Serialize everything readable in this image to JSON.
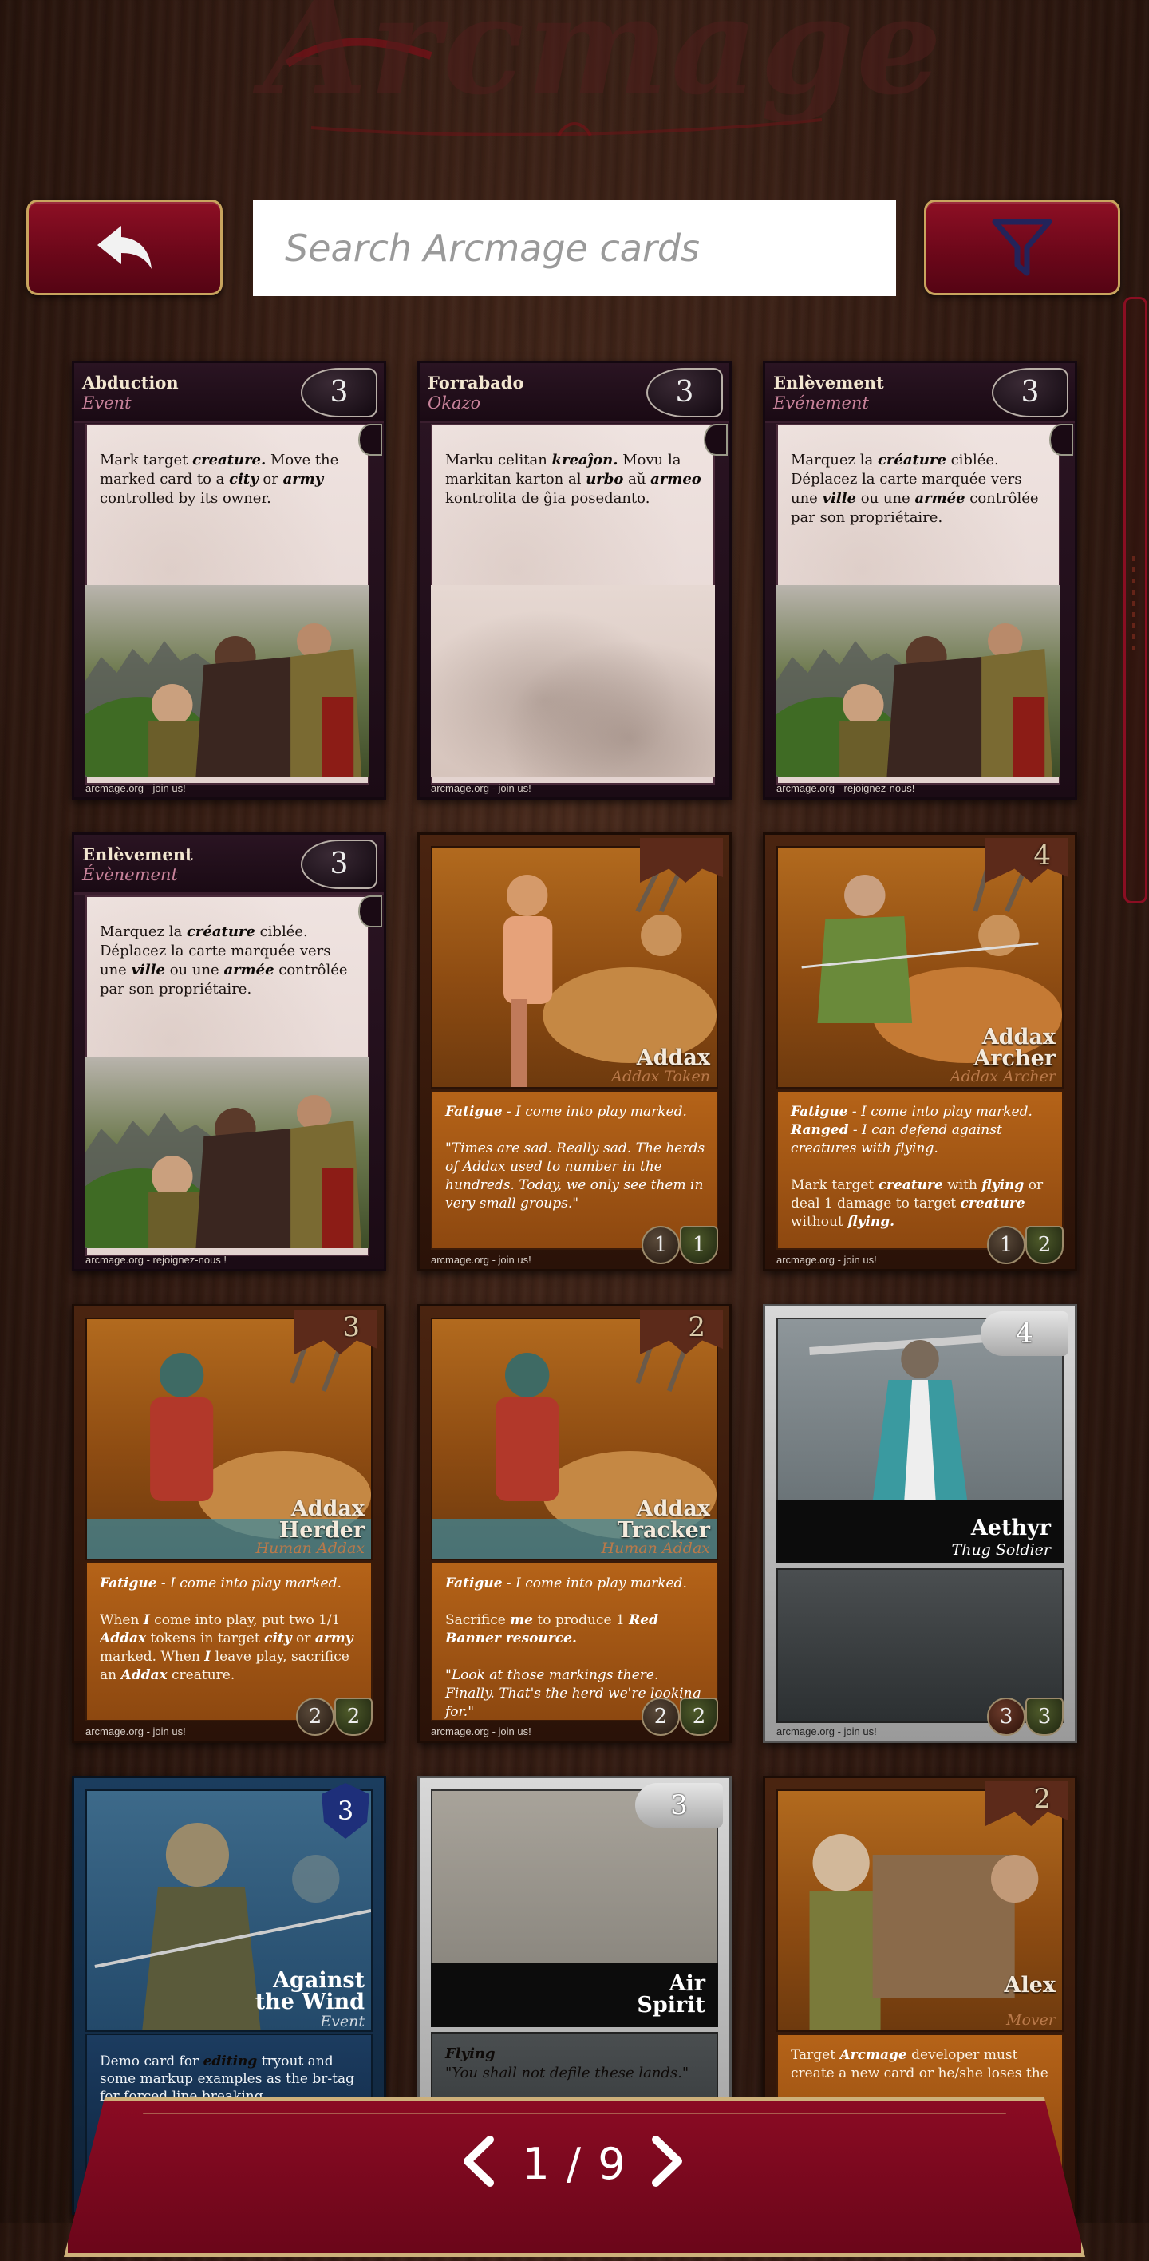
{
  "header": {
    "logo_text": "Arcmage"
  },
  "toolbar": {
    "back_icon": "back-arrow-icon",
    "search_placeholder": "Search Arcmage cards",
    "filter_icon": "filter-funnel-icon"
  },
  "cards": [
    {
      "name": "Abduction",
      "type": "Event",
      "cost": "3",
      "rules_html": "Mark target <b><i>creature.</i></b> Move the marked card to a <b><i>city</i></b> or <b><i>army</i></b> controlled by its owner.",
      "footer": "arcmage.org - join us!"
    },
    {
      "name": "Forrabado",
      "type": "Okazo",
      "cost": "3",
      "rules_html": "Marku celitan <b><i>kreaĵon.</i></b> Movu la markitan karton al <b><i>urbo</i></b>  aŭ <b><i>armeo</i></b> kontrolita de ĝia posedanto.",
      "footer": "arcmage.org - join us!"
    },
    {
      "name": "Enlèvement",
      "type": "Evénement",
      "cost": "3",
      "rules_html": "Marquez la <b><i>créature</i></b> ciblée. Déplacez la carte marquée vers une <b><i>ville</i></b> ou une <b><i>armée</i></b> contrôlée par son propriétaire.",
      "footer": "arcmage.org - rejoignez-nous!"
    },
    {
      "name": "Enlèvement",
      "type": "Évènement",
      "cost": "3",
      "rules_html": "Marquez la <b><i>créature</i></b> ciblée.<br>Déplacez la carte marquée vers une <b><i>ville</i></b> ou une <b><i>armée</i></b> contrôlée par son propriétaire.",
      "footer": "arcmage.org - rejoignez-nous !"
    },
    {
      "name": "Addax",
      "type": "Addax Token",
      "cost": "",
      "rules_html": "<b><i>Fatigue</i></b><i> - I come into play marked.</i><br><br><i>\"Times are sad. Really sad. The herds of Addax used to number in the hundreds. Today, we only see them in very small groups.\"</i>",
      "stats": [
        "1",
        "1"
      ],
      "footer": "arcmage.org - join us!"
    },
    {
      "name": "Addax Archer",
      "type": "Addax Archer",
      "cost": "4",
      "rules_html": "<b><i>Fatigue</i></b><i> - I come into play marked.</i><br><b><i>Ranged</i></b><i> - I can defend against creatures with flying.</i><br><br>Mark target <b><i>creature</i></b> with <b><i>flying</i></b> or deal 1 damage to target <b><i>creature</i></b> without <b><i>flying.</i></b>",
      "stats": [
        "1",
        "2"
      ],
      "footer": "arcmage.org - join us!"
    },
    {
      "name": "Addax Herder",
      "type": "Human Addax",
      "cost": "3",
      "rules_html": "<b><i>Fatigue</i></b><i> - I come into play marked.</i><br><br>When <b><i>I</i></b> come into play, put two 1/1 <b><i>Addax</i></b> tokens in target <b><i>city</i></b> or <b><i>army</i></b> marked. When <b><i>I</i></b> leave play, sacrifice an <b><i>Addax</i></b> creature.",
      "stats": [
        "2",
        "2"
      ],
      "footer": "arcmage.org - join us!"
    },
    {
      "name": "Addax Tracker",
      "type": "Human Addax",
      "cost": "2",
      "rules_html": "<b><i>Fatigue</i></b><i> - I come into play marked.</i><br><br>Sacrifice <b><i>me</i></b> to produce 1 <b><i>Red Banner resource.</i></b><br><br><i>\"Look at those markings there. Finally. That's the herd we're looking for.\"</i>",
      "stats": [
        "2",
        "2"
      ],
      "footer": "arcmage.org - join us!"
    },
    {
      "name": "Aethyr",
      "type": "Thug Soldier",
      "cost": "4",
      "stats": [
        "3",
        "3"
      ],
      "footer": "arcmage.org - join us!"
    },
    {
      "name": "Against the Wind",
      "type": "Event",
      "cost": "3",
      "rules_html": "Demo card for <b><i>editing</i></b> tryout and some markup examples as the br-tag for forced line breaking."
    },
    {
      "name": "Air Spirit",
      "type": "",
      "cost": "3",
      "rules_html": "<b><i>Flying</i></b><br><i>\"You shall not defile these lands.\"</i>"
    },
    {
      "name": "Alex",
      "type": "Mover",
      "cost": "2",
      "rules_html": "Target <b><i>Arcmage</i></b> developer must create a new card or he/she loses the"
    }
  ],
  "pager": {
    "label": "1 / 9",
    "current": 1,
    "total": 9
  },
  "colors": {
    "accent": "#7a0a1e",
    "gold": "#c8a45e",
    "wood": "#3a1f14"
  }
}
